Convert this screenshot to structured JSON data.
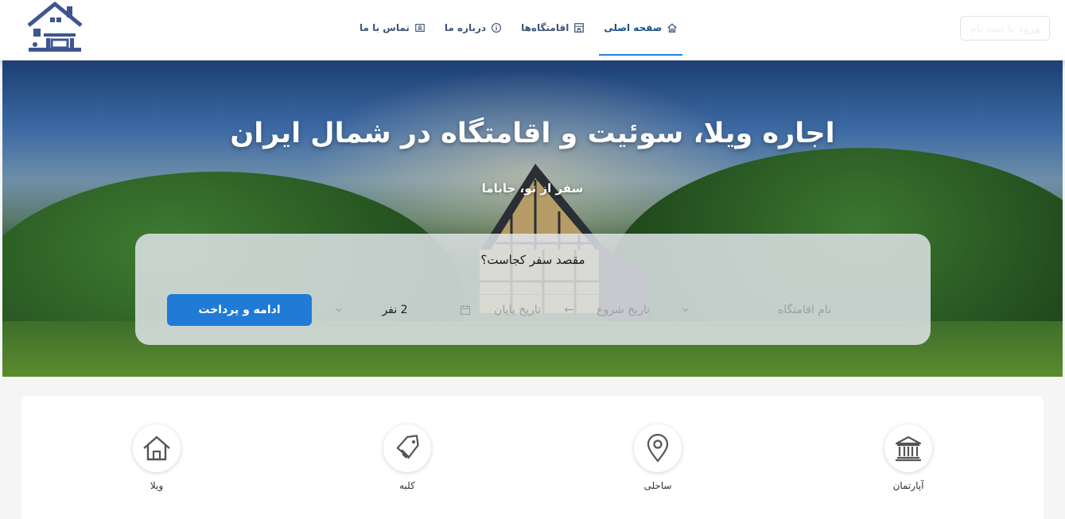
{
  "header": {
    "login_label": "ورود یا ثبت نام",
    "nav": [
      {
        "label": "صفحه اصلی",
        "icon": "home-icon",
        "active": true
      },
      {
        "label": "اقامتگاه‌ها",
        "icon": "building-icon",
        "active": false
      },
      {
        "label": "درباره ما",
        "icon": "info-icon",
        "active": false
      },
      {
        "label": "تماس با ما",
        "icon": "contact-card-icon",
        "active": false
      }
    ]
  },
  "hero": {
    "title": "اجاره ویلا، سوئیت و اقامتگاه در شمال ایران",
    "subtitle": "سفر از تو، جاباما"
  },
  "search": {
    "question": "مقصد سفر کجاست؟",
    "place_placeholder": "نام اقامتگاه",
    "start_date_placeholder": "تاریخ شروع",
    "date_arrow": "←",
    "end_date_placeholder": "تاریخ پایان",
    "guests_value": "2 نفر",
    "submit_label": "ادامه و پرداخت"
  },
  "categories": [
    {
      "label": "آپارتمان",
      "icon": "bank-building-icon"
    },
    {
      "label": "ساحلی",
      "icon": "location-pin-icon"
    },
    {
      "label": "کلبه",
      "icon": "tag-icon"
    },
    {
      "label": "ویلا",
      "icon": "house-icon"
    }
  ],
  "colors": {
    "accent": "#1f7bd6",
    "nav_text": "#3e5374",
    "logo": "#3f5590"
  }
}
